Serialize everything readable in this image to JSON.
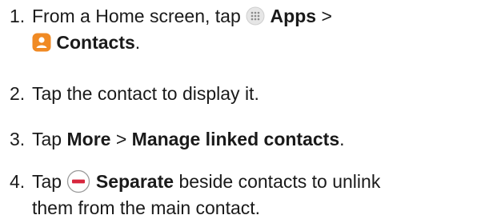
{
  "steps": [
    {
      "num": "1.",
      "t1": "From a Home screen, tap",
      "apps": "Apps",
      "sep": ">",
      "contacts": "Contacts",
      "end": "."
    },
    {
      "num": "2.",
      "text": "Tap the contact to display it."
    },
    {
      "num": "3.",
      "t1": "Tap",
      "more": "More",
      "sep": ">",
      "manage": "Manage linked contacts",
      "end": "."
    },
    {
      "num": "4.",
      "t1": "Tap",
      "separate": "Separate",
      "t2": "beside contacts to unlink",
      "t3": "them from the main contact."
    }
  ],
  "icons": {
    "apps": "apps-grid-icon",
    "contacts": "contacts-app-icon",
    "separate": "minus-circle-icon"
  },
  "colors": {
    "text": "#1a1a1a",
    "contacts_icon": "#f08a24",
    "separate_icon": "#d7263d",
    "apps_icon": "#e6e6e6"
  }
}
